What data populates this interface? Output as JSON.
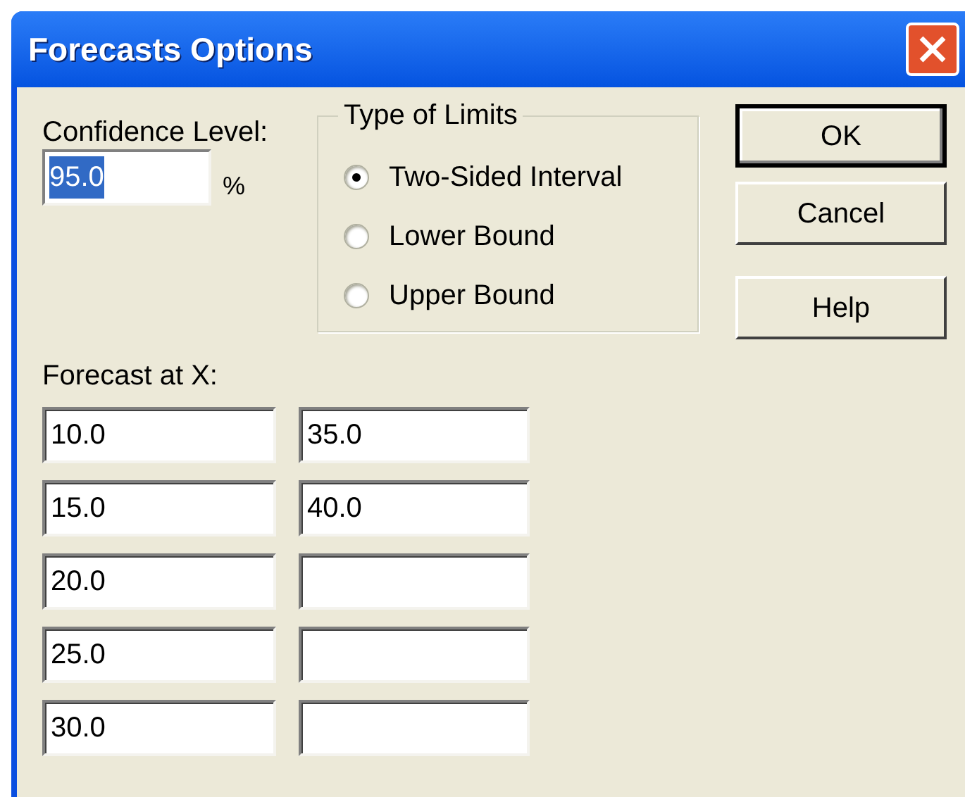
{
  "window": {
    "title": "Forecasts Options"
  },
  "confidence": {
    "label": "Confidence Level:",
    "value": "95.0",
    "selected": true,
    "unit": "%"
  },
  "limits": {
    "title": "Type of Limits",
    "options": [
      {
        "label": "Two-Sided Interval",
        "selected": true
      },
      {
        "label": "Lower Bound",
        "selected": false
      },
      {
        "label": "Upper Bound",
        "selected": false
      }
    ]
  },
  "buttons": [
    {
      "label": "OK",
      "default": true
    },
    {
      "label": "Cancel",
      "default": false
    },
    {
      "label": "Help",
      "default": false
    }
  ],
  "forecast": {
    "label": "Forecast at X:",
    "rows": [
      {
        "column_1": "10.0",
        "column_2": "35.0"
      },
      {
        "column_1": "15.0",
        "column_2": "40.0"
      },
      {
        "column_1": "20.0"
      },
      {
        "column_1": "25.0"
      },
      {
        "column_1": "30.0"
      }
    ]
  }
}
